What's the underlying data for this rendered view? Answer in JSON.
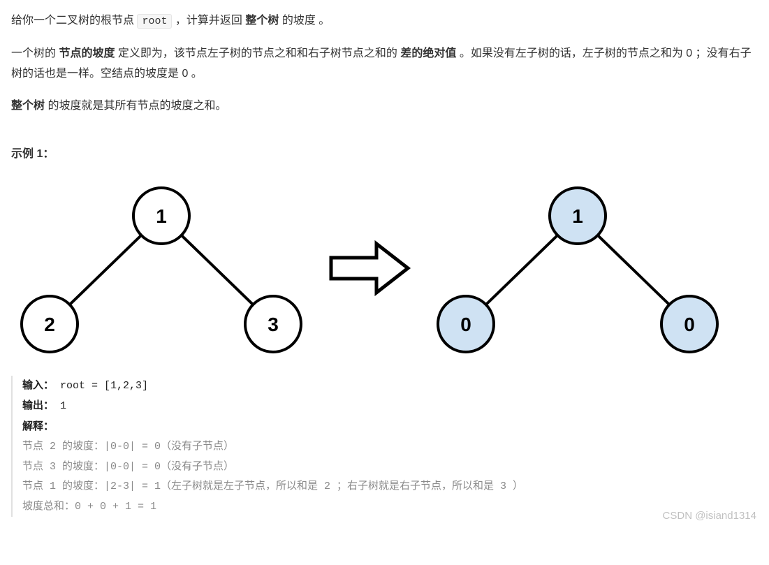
{
  "problem": {
    "p1_pre": "给你一个二叉树的根节点 ",
    "p1_code": "root",
    "p1_post": " ，计算并返回 ",
    "p1_bold": "整个树",
    "p1_tail": " 的坡度 。",
    "p2_a": "一个树的 ",
    "p2_b_bold": "节点的坡度",
    "p2_c": " 定义即为，该节点左子树的节点之和和右子树节点之和的 ",
    "p2_d_bold": "差的绝对值",
    "p2_e": " 。如果没有左子树的话，左子树的节点之和为 0 ；没有右子树的话也是一样。空结点的坡度是 0 。",
    "p3_a_bold": "整个树",
    "p3_b": " 的坡度就是其所有节点的坡度之和。"
  },
  "example_heading": "示例 1：",
  "trees": {
    "left": {
      "root": "1",
      "l": "2",
      "r": "3",
      "fill": "#ffffff"
    },
    "right": {
      "root": "1",
      "l": "0",
      "r": "0",
      "fill": "#cfe2f3"
    }
  },
  "example": {
    "input_label": "输入：",
    "input_val": "root = [1,2,3]",
    "output_label": "输出：",
    "output_val": "1",
    "explain_label": "解释：",
    "lines": [
      "节点 2 的坡度：|0-0| = 0（没有子节点）",
      "节点 3 的坡度：|0-0| = 0（没有子节点）",
      "节点 1 的坡度：|2-3| = 1（左子树就是左子节点，所以和是 2 ；右子树就是右子节点，所以和是 3 ）",
      "坡度总和：0 + 0 + 1 = 1"
    ]
  },
  "watermark": "CSDN @isiand1314"
}
